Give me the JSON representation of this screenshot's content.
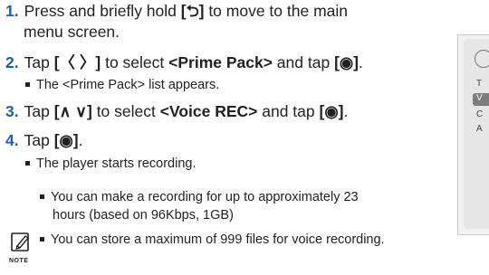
{
  "steps": [
    {
      "num": "1.",
      "pre": "Press and briefly hold ",
      "key1": "[⮌]",
      "post": " to move to the main",
      "cont": "menu screen."
    },
    {
      "num": "2.",
      "pre": "Tap ",
      "key1": "[〈 〉]",
      "mid": " to select ",
      "item": "<Prime Pack>",
      "mid2": " and tap ",
      "key2": "[◉]",
      "end": ".",
      "bullet": "The <Prime Pack> list appears."
    },
    {
      "num": "3.",
      "pre": "Tap ",
      "key1": "[∧ ∨]",
      "mid": " to select ",
      "item": "<Voice REC>",
      "mid2": " and tap ",
      "key2": "[◉]",
      "end": "."
    },
    {
      "num": "4.",
      "pre": "Tap ",
      "key1": "[◉]",
      "end": ".",
      "bullet": "The player starts recording."
    }
  ],
  "note": {
    "label": "NOTE",
    "line1": "You can make a recording for up to approximately 23",
    "line1b": "hours (based on 96Kbps, 1GB)",
    "line2": "You can store a maximum of 999 files for voice recording."
  },
  "device": {
    "row_t": "T",
    "row_v": "V",
    "row_c": "C",
    "row_a": "A"
  },
  "colors": {
    "step_number": "#1a5fb4",
    "text": "#222222"
  }
}
